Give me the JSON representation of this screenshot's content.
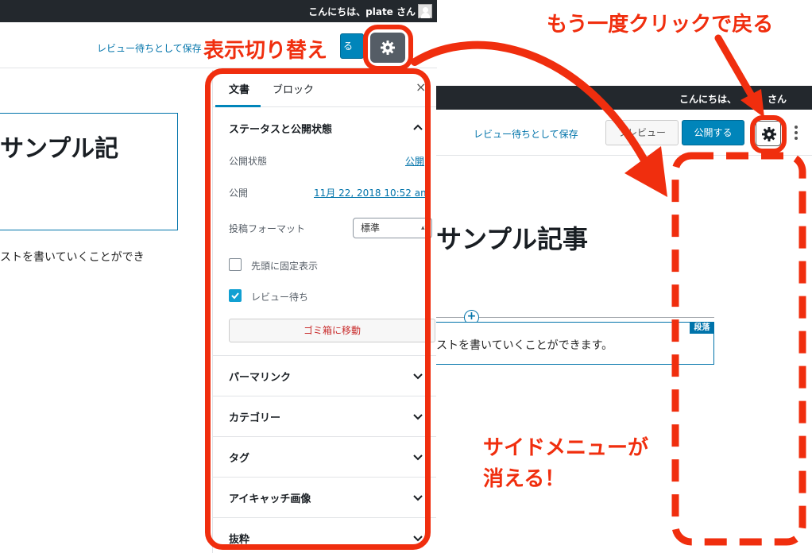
{
  "left_screen": {
    "greeting": "こんにちは、plate さん",
    "save_link": "レビュー待ちとして保存",
    "publish_fragment": "る",
    "post_title": "サンプル記",
    "body_text": "ストを書いていくことができ",
    "sidebar": {
      "tab_document": "文書",
      "tab_block": "ブロック",
      "close": "×",
      "status_heading": "ステータスと公開状態",
      "visibility_label": "公開状態",
      "visibility_value": "公開",
      "publish_label": "公開",
      "publish_value": "11月 22, 2018 10:52 am",
      "format_label": "投稿フォーマット",
      "format_value": "標準",
      "sticky_label": "先頭に固定表示",
      "pending_label": "レビュー待ち",
      "trash_button": "ゴミ箱に移動",
      "sections": [
        "パーマリンク",
        "カテゴリー",
        "タグ",
        "アイキャッチ画像",
        "抜粋"
      ]
    }
  },
  "right_screen": {
    "greeting_start": "こんにちは、",
    "greeting_end": "さん",
    "save_link": "レビュー待ちとして保存",
    "preview_button": "プレビュー",
    "publish_button": "公開する",
    "post_title": "サンプル記事",
    "block_tag": "段落",
    "body_text": "ストを書いていくことができます。"
  },
  "annotations": {
    "toggle_label": "表示切り替え",
    "click_again_label": "もう一度クリックで戻る",
    "menu_disappears_line1": "サイドメニューが",
    "menu_disappears_line2": "消える！"
  },
  "colors": {
    "annotation_red": "#f02e0e",
    "admin_bar": "#23282d",
    "primary_blue": "#0085ba",
    "link_blue": "#0073aa"
  },
  "icons": [
    "gear-icon",
    "close-icon",
    "chevron-up-icon",
    "chevron-down-icon",
    "checkbox-checked-icon",
    "checkbox-empty-icon",
    "kebab-menu-icon",
    "plus-circle-icon",
    "avatar-icon"
  ]
}
